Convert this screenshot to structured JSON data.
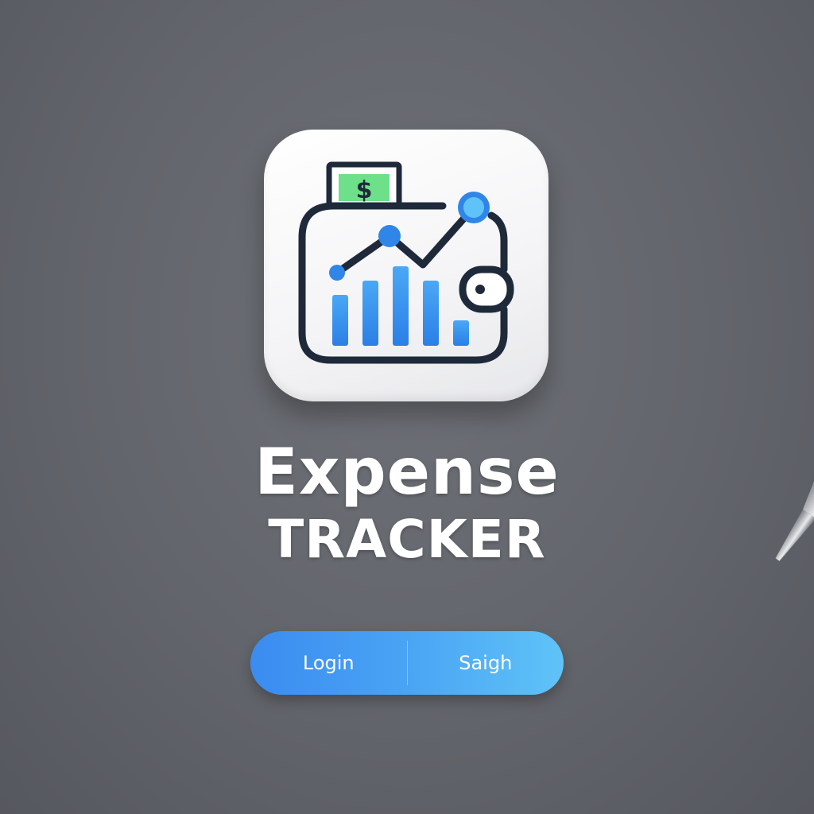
{
  "app": {
    "icon_name": "wallet-chart-icon",
    "currency_symbol": "$",
    "title_line_1": "Expense",
    "title_line_2": "TRACKER"
  },
  "auth": {
    "login_label": "Login",
    "signup_label": "Saigh"
  },
  "colors": {
    "background": "#62656b",
    "icon_outline": "#1e2a3a",
    "accent_blue": "#2f86e8",
    "accent_light_blue": "#5fc3f8",
    "money_green": "#6ee08a"
  },
  "decor": {
    "pen_icon": "pen-icon"
  }
}
